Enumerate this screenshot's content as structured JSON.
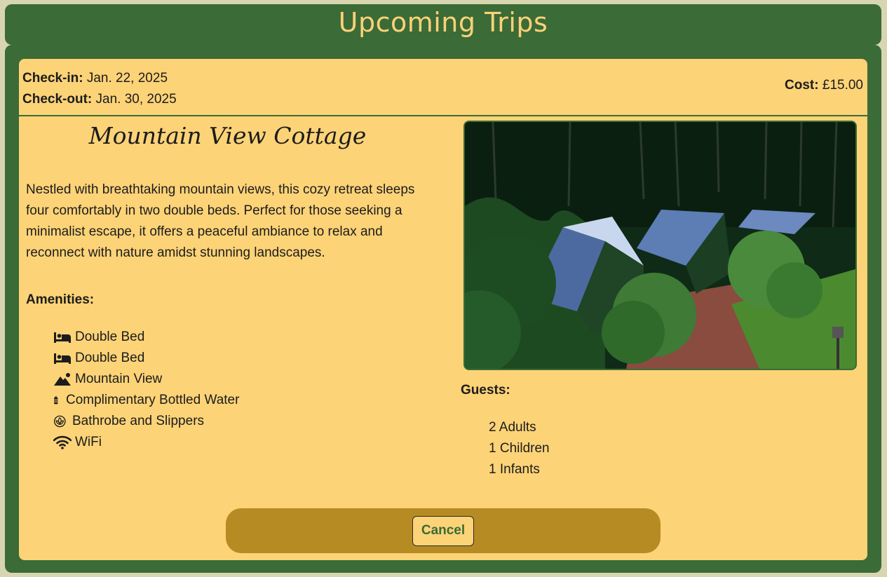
{
  "page": {
    "title": "Upcoming Trips"
  },
  "booking": {
    "checkin_label": "Check-in:",
    "checkin_value": "Jan. 22, 2025",
    "checkout_label": "Check-out:",
    "checkout_value": "Jan. 30, 2025",
    "cost_label": "Cost:",
    "cost_value": "£15.00"
  },
  "property": {
    "name": "Mountain View Cottage",
    "description": "Nestled with breathtaking mountain views, this cozy retreat sleeps four comfortably in two double beds. Perfect for those seeking a minimalist escape, it offers a peaceful ambiance to relax and reconnect with nature amidst stunning landscapes.",
    "image_alt": "Mountain View Cottage"
  },
  "amenities": {
    "heading": "Amenities:",
    "items": [
      {
        "icon": "bed-icon",
        "label": "Double Bed"
      },
      {
        "icon": "bed-icon",
        "label": "Double Bed"
      },
      {
        "icon": "mountain-sun-icon",
        "label": "Mountain View"
      },
      {
        "icon": "bottle-water-icon",
        "label": "Complimentary Bottled Water"
      },
      {
        "icon": "spa-icon",
        "label": "Bathrobe and Slippers"
      },
      {
        "icon": "wifi-icon",
        "label": "WiFi"
      }
    ]
  },
  "guests": {
    "heading": "Guests:",
    "items": [
      "2 Adults",
      "1 Children",
      "1 Infants"
    ]
  },
  "actions": {
    "cancel_label": "Cancel"
  },
  "colors": {
    "primary_green": "#3b6b36",
    "card_yellow": "#fdd377",
    "button_bar_gold": "#b78b24",
    "title_text": "#fcd178"
  }
}
